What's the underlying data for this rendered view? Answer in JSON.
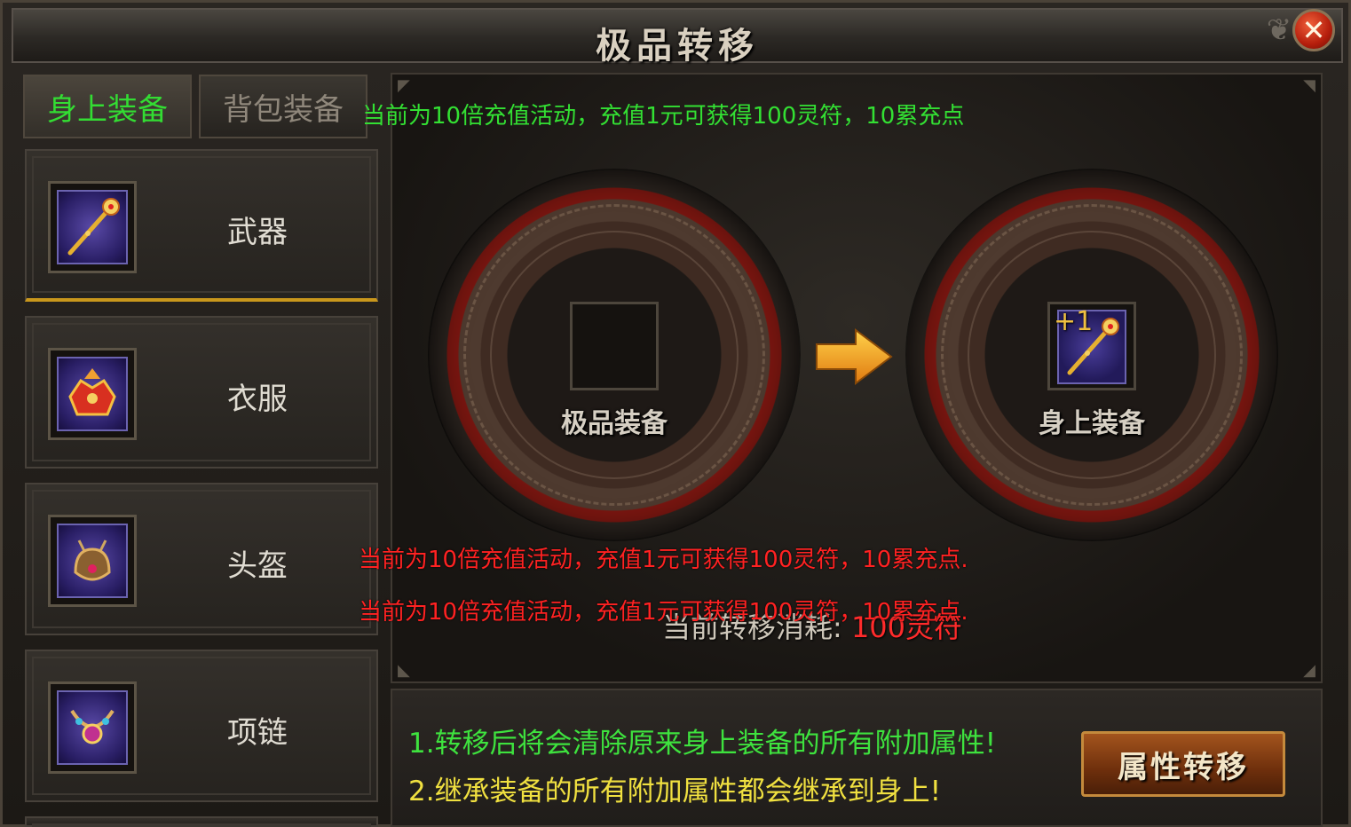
{
  "window": {
    "title": "极品转移",
    "close_label": "✕"
  },
  "tabs": [
    {
      "label": "身上装备",
      "active": true
    },
    {
      "label": "背包装备",
      "active": false
    }
  ],
  "notices": {
    "top": "当前为10倍充值活动，充值1元可获得100灵符，10累充点",
    "scroll_1": "当前为10倍充值活动，充值1元可获得100灵符，10累充点.",
    "scroll_2": "当前为10倍充值活动，充值1元可获得100灵符，10累充点."
  },
  "equipment_list": [
    {
      "label": "武器",
      "icon": "staff-icon",
      "selected": true
    },
    {
      "label": "衣服",
      "icon": "armor-icon",
      "selected": false
    },
    {
      "label": "头盔",
      "icon": "helmet-icon",
      "selected": false
    },
    {
      "label": "项链",
      "icon": "necklace-icon",
      "selected": false
    }
  ],
  "transfer": {
    "source_caption": "极品装备",
    "target_caption": "身上装备",
    "target_badge": "+1",
    "target_icon": "staff-icon",
    "cost_label": "当前转移消耗:",
    "cost_value": "100灵符"
  },
  "rules": {
    "line_1": "1.转移后将会清除原来身上装备的所有附加属性!",
    "line_2": "2.继承装备的所有附加属性都会继承到身上!"
  },
  "action_button": "属性转移",
  "colors": {
    "active_tab": "#33dd33",
    "notice_red": "#ff2222",
    "rule_1": "#3ee23e",
    "rule_2": "#f0e040",
    "selected_underline": "#c9971c"
  }
}
